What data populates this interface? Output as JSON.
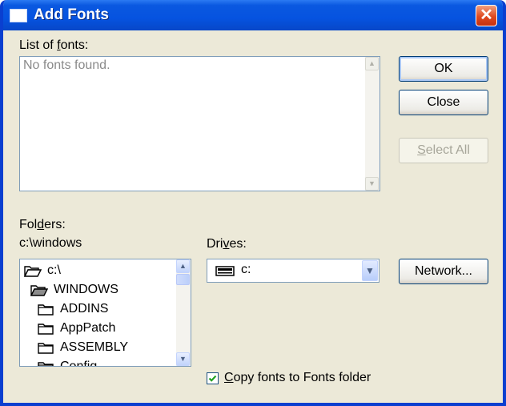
{
  "window": {
    "title": "Add Fonts",
    "close_glyph": "✕"
  },
  "fonts": {
    "label_pre": "List of ",
    "label_u": "f",
    "label_post": "onts:",
    "empty_text": "No fonts found."
  },
  "buttons": {
    "ok": "OK",
    "close": "Close",
    "select_all_u": "S",
    "select_all_rest": "elect All",
    "network": "Network..."
  },
  "folders": {
    "label_pre": "Fol",
    "label_u": "d",
    "label_post": "ers:",
    "current_path": "c:\\windows",
    "items": [
      "c:\\",
      "WINDOWS",
      "ADDINS",
      "AppPatch",
      "ASSEMBLY",
      "Config"
    ]
  },
  "drives": {
    "label_pre": "Dri",
    "label_u": "v",
    "label_post": "es:",
    "selected": "c:"
  },
  "copy_option": {
    "label_u": "C",
    "label_rest": "opy fonts to Fonts folder",
    "checked": true
  },
  "icons": [
    "window-icon",
    "close-icon",
    "folder-open-icon",
    "folder-icon",
    "drive-icon",
    "chevron-down-icon",
    "chevron-up-icon",
    "check-icon"
  ]
}
